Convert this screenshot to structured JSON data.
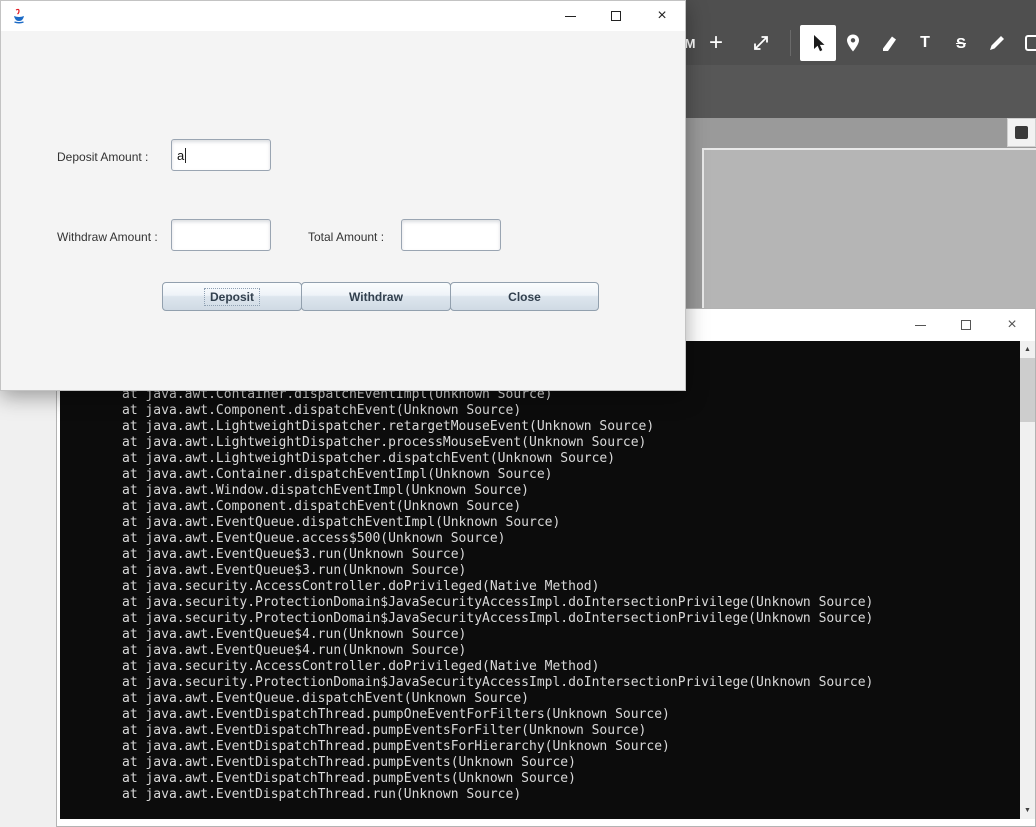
{
  "bank_window": {
    "form": {
      "deposit_label": "Deposit Amount :",
      "deposit_value": "a",
      "withdraw_label": "Withdraw Amount :",
      "withdraw_value": "",
      "total_label": "Total Amount :",
      "total_value": ""
    },
    "buttons": {
      "deposit": "Deposit",
      "withdraw": "Withdraw",
      "close": "Close"
    }
  },
  "annotation_toolbar": {
    "zoom_label_fragment": "M",
    "zoom_in_label": "+",
    "text_tool_label": "T",
    "strikethrough_tool_label": "S"
  },
  "window_glyphs": {
    "close": "×"
  },
  "console_window": {
    "scrollbar_up": "▲",
    "scrollbar_down": "▼",
    "stack_trace": [
      "at java.awt.Container.dispatchEventImpl(Unknown Source)",
      "at java.awt.Component.dispatchEvent(Unknown Source)",
      "at java.awt.LightweightDispatcher.retargetMouseEvent(Unknown Source)",
      "at java.awt.LightweightDispatcher.processMouseEvent(Unknown Source)",
      "at java.awt.LightweightDispatcher.dispatchEvent(Unknown Source)",
      "at java.awt.Container.dispatchEventImpl(Unknown Source)",
      "at java.awt.Window.dispatchEventImpl(Unknown Source)",
      "at java.awt.Component.dispatchEvent(Unknown Source)",
      "at java.awt.EventQueue.dispatchEventImpl(Unknown Source)",
      "at java.awt.EventQueue.access$500(Unknown Source)",
      "at java.awt.EventQueue$3.run(Unknown Source)",
      "at java.awt.EventQueue$3.run(Unknown Source)",
      "at java.security.AccessController.doPrivileged(Native Method)",
      "at java.security.ProtectionDomain$JavaSecurityAccessImpl.doIntersectionPrivilege(Unknown Source)",
      "at java.security.ProtectionDomain$JavaSecurityAccessImpl.doIntersectionPrivilege(Unknown Source)",
      "at java.awt.EventQueue$4.run(Unknown Source)",
      "at java.awt.EventQueue$4.run(Unknown Source)",
      "at java.security.AccessController.doPrivileged(Native Method)",
      "at java.security.ProtectionDomain$JavaSecurityAccessImpl.doIntersectionPrivilege(Unknown Source)",
      "at java.awt.EventQueue.dispatchEvent(Unknown Source)",
      "at java.awt.EventDispatchThread.pumpOneEventForFilters(Unknown Source)",
      "at java.awt.EventDispatchThread.pumpEventsForFilter(Unknown Source)",
      "at java.awt.EventDispatchThread.pumpEventsForHierarchy(Unknown Source)",
      "at java.awt.EventDispatchThread.pumpEvents(Unknown Source)",
      "at java.awt.EventDispatchThread.pumpEvents(Unknown Source)",
      "at java.awt.EventDispatchThread.run(Unknown Source)"
    ]
  },
  "colors": {
    "toolbar_bg": "#4f4f4f",
    "console_bg": "#0c0c0c",
    "console_text": "#d9d9d9",
    "nimbus_border": "#92a0ae",
    "desktop_bg": "#f0f0f0"
  }
}
